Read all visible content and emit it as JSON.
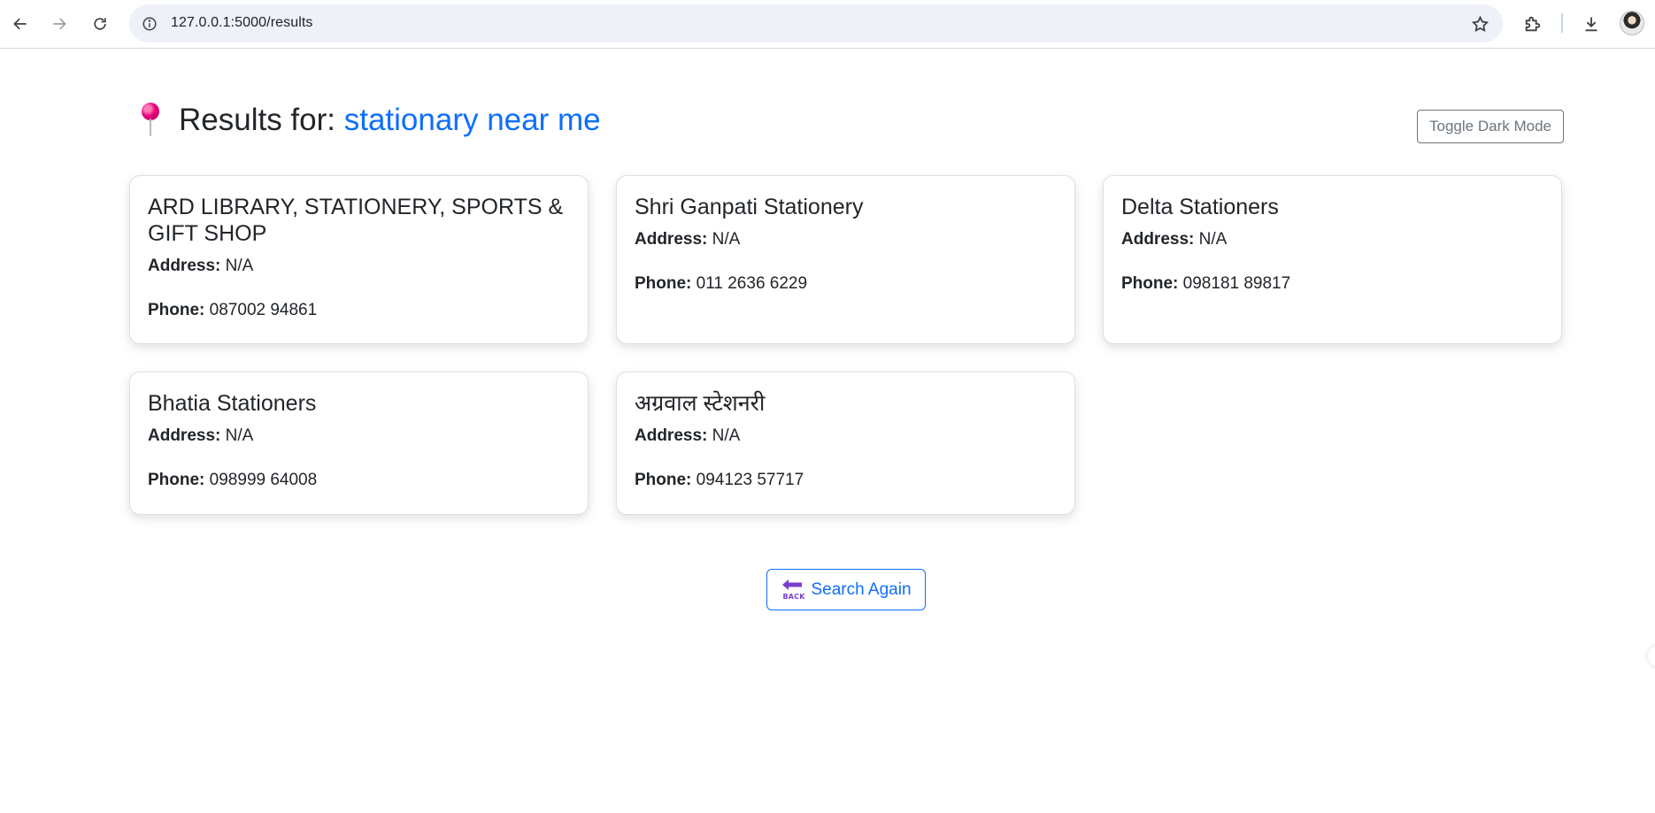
{
  "browser": {
    "url": "127.0.0.1:5000/results"
  },
  "header": {
    "title_prefix": "Results for:",
    "query": "stationary near me",
    "toggle_label": "Toggle Dark Mode"
  },
  "labels": {
    "address": "Address:",
    "phone": "Phone:"
  },
  "results": [
    {
      "name": "ARD LIBRARY, STATIONERY, SPORTS & GIFT SHOP",
      "address": "N/A",
      "phone": "087002 94861"
    },
    {
      "name": "Shri Ganpati Stationery",
      "address": "N/A",
      "phone": "011 2636 6229"
    },
    {
      "name": "Delta Stationers",
      "address": "N/A",
      "phone": "098181 89817"
    },
    {
      "name": "Bhatia Stationers",
      "address": "N/A",
      "phone": "098999 64008"
    },
    {
      "name": "अग्रवाल स्टेशनरी",
      "address": "N/A",
      "phone": "094123 57717"
    }
  ],
  "footer": {
    "search_again_label": "Search Again",
    "back_icon_text": "BACK"
  },
  "colors": {
    "accent": "#0d6efd",
    "pin": "#e6007a",
    "back_icon": "#7b3fd0"
  }
}
